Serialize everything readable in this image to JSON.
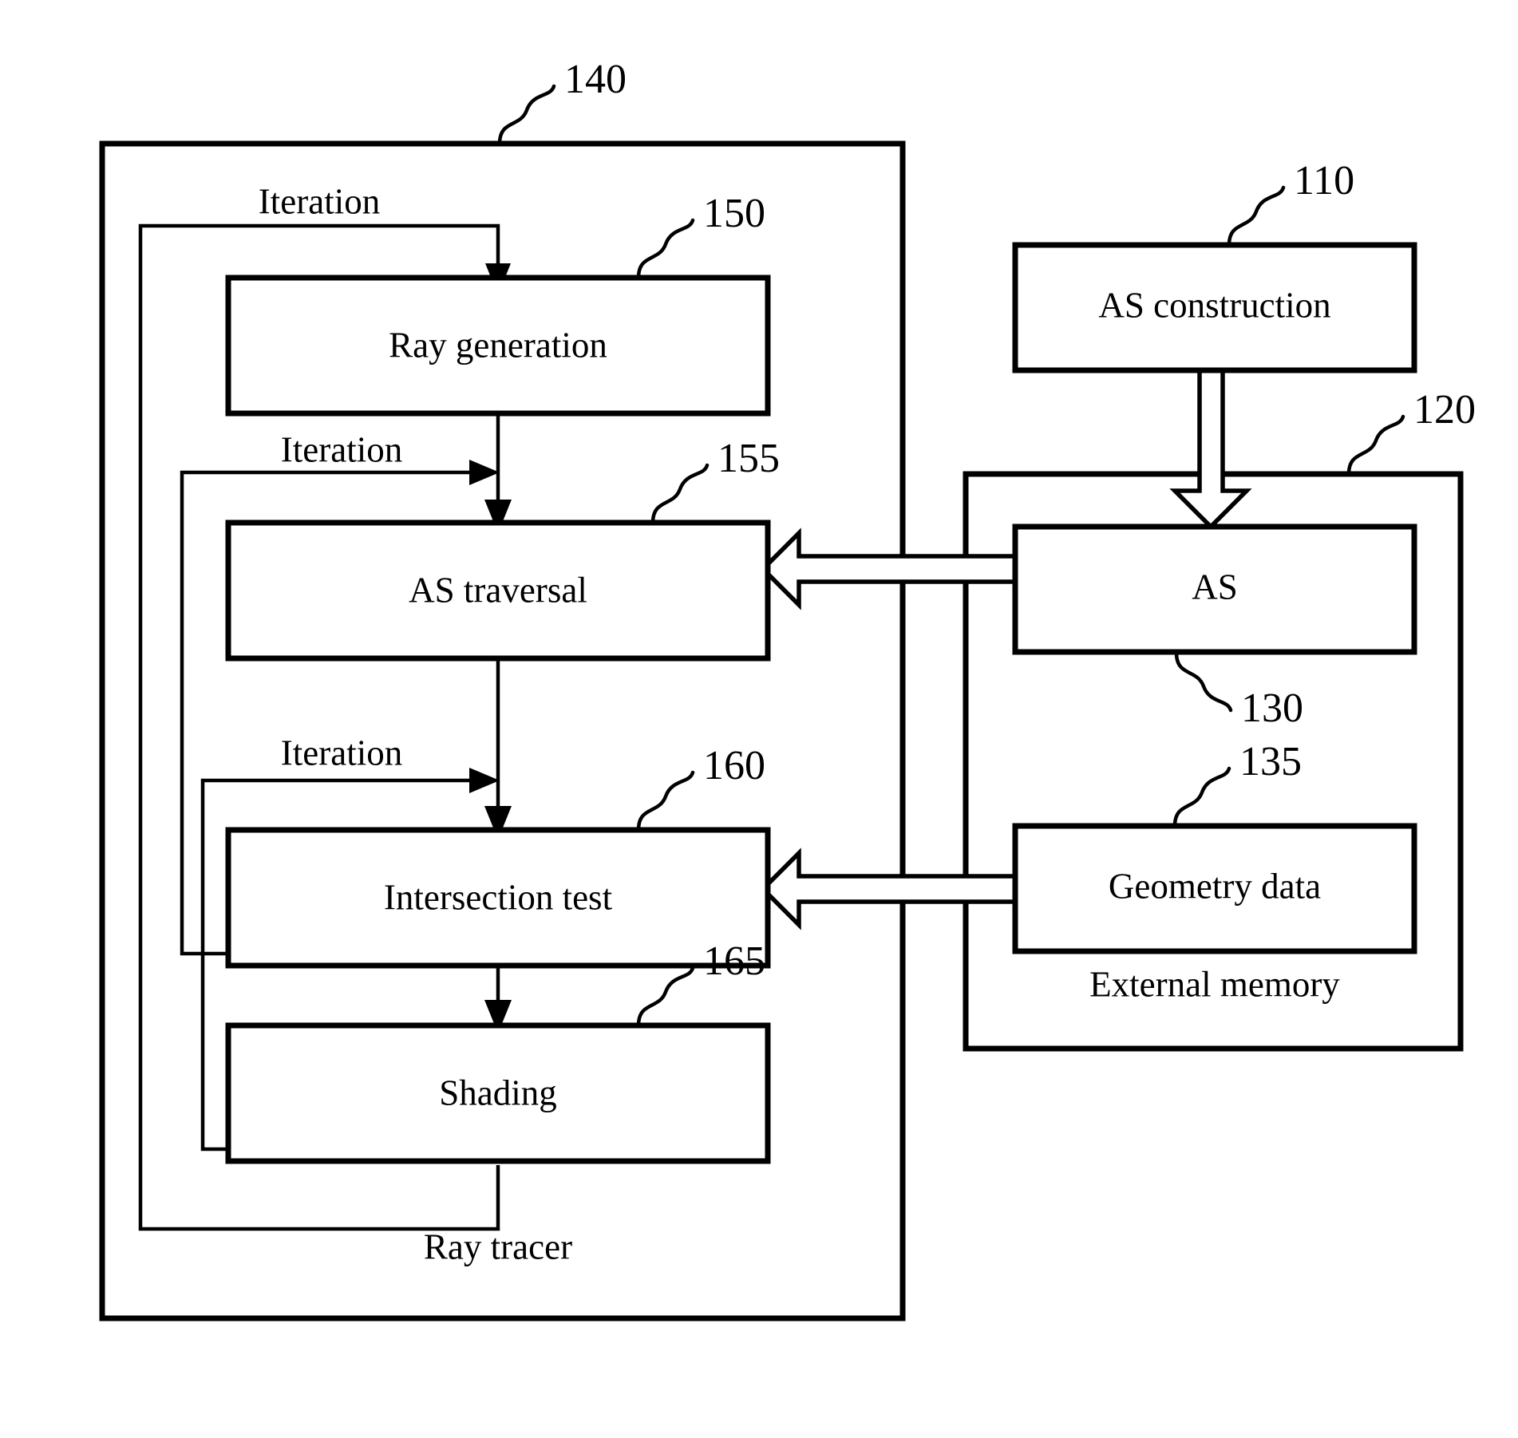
{
  "figure": {
    "type": "patent-block-diagram",
    "background": "#ffffff",
    "line_color": "#000000"
  },
  "containers": [
    {
      "id": "ray-tracer",
      "ref": "140",
      "caption": "Ray tracer"
    },
    {
      "id": "external-memory",
      "ref": "120",
      "caption": "External memory"
    }
  ],
  "blocks": [
    {
      "id": "ray-generation",
      "label": "Ray generation",
      "ref": "150"
    },
    {
      "id": "as-traversal",
      "label": "AS traversal",
      "ref": "155"
    },
    {
      "id": "intersection-test",
      "label": "Intersection test",
      "ref": "160"
    },
    {
      "id": "shading",
      "label": "Shading",
      "ref": "165"
    },
    {
      "id": "as-construction",
      "label": "AS construction",
      "ref": "110"
    },
    {
      "id": "as",
      "label": "AS",
      "ref": "130"
    },
    {
      "id": "geometry-data",
      "label": "Geometry data",
      "ref": "135"
    }
  ],
  "iteration_labels": [
    {
      "id": "iteration-outer",
      "label": "Iteration"
    },
    {
      "id": "iteration-as-traversal",
      "label": "Iteration"
    },
    {
      "id": "iteration-intersection",
      "label": "Iteration"
    }
  ],
  "ref_numbers": {
    "ray_tracer": "140",
    "ray_generation": "150",
    "as_traversal": "155",
    "intersection_test": "160",
    "shading": "165",
    "as_construction": "110",
    "external_memory": "120",
    "as": "130",
    "geometry_data": "135"
  },
  "captions": {
    "ray_tracer": "Ray tracer",
    "external_memory": "External memory"
  },
  "data_flows": [
    {
      "from": "as-construction",
      "to": "as",
      "style": "hollow-block-arrow",
      "direction": "down"
    },
    {
      "from": "as",
      "to": "as-traversal",
      "style": "hollow-block-arrow",
      "direction": "left"
    },
    {
      "from": "geometry-data",
      "to": "intersection-test",
      "style": "hollow-block-arrow",
      "direction": "left"
    }
  ],
  "control_flows": [
    {
      "from": "ray-generation",
      "to": "as-traversal",
      "style": "solid-arrow",
      "direction": "down"
    },
    {
      "from": "as-traversal",
      "to": "intersection-test",
      "style": "solid-arrow",
      "direction": "down"
    },
    {
      "from": "intersection-test",
      "to": "shading",
      "style": "solid-arrow",
      "direction": "down"
    },
    {
      "from": "shading",
      "to": "ray-generation",
      "style": "solid-arrow",
      "direction": "feedback-outer",
      "label": "Iteration"
    },
    {
      "from": "intersection-test",
      "to": "as-traversal",
      "style": "solid-arrow",
      "direction": "feedback",
      "label": "Iteration"
    },
    {
      "from": "shading",
      "to": "intersection-test",
      "style": "solid-arrow",
      "direction": "feedback",
      "label": "Iteration"
    }
  ]
}
